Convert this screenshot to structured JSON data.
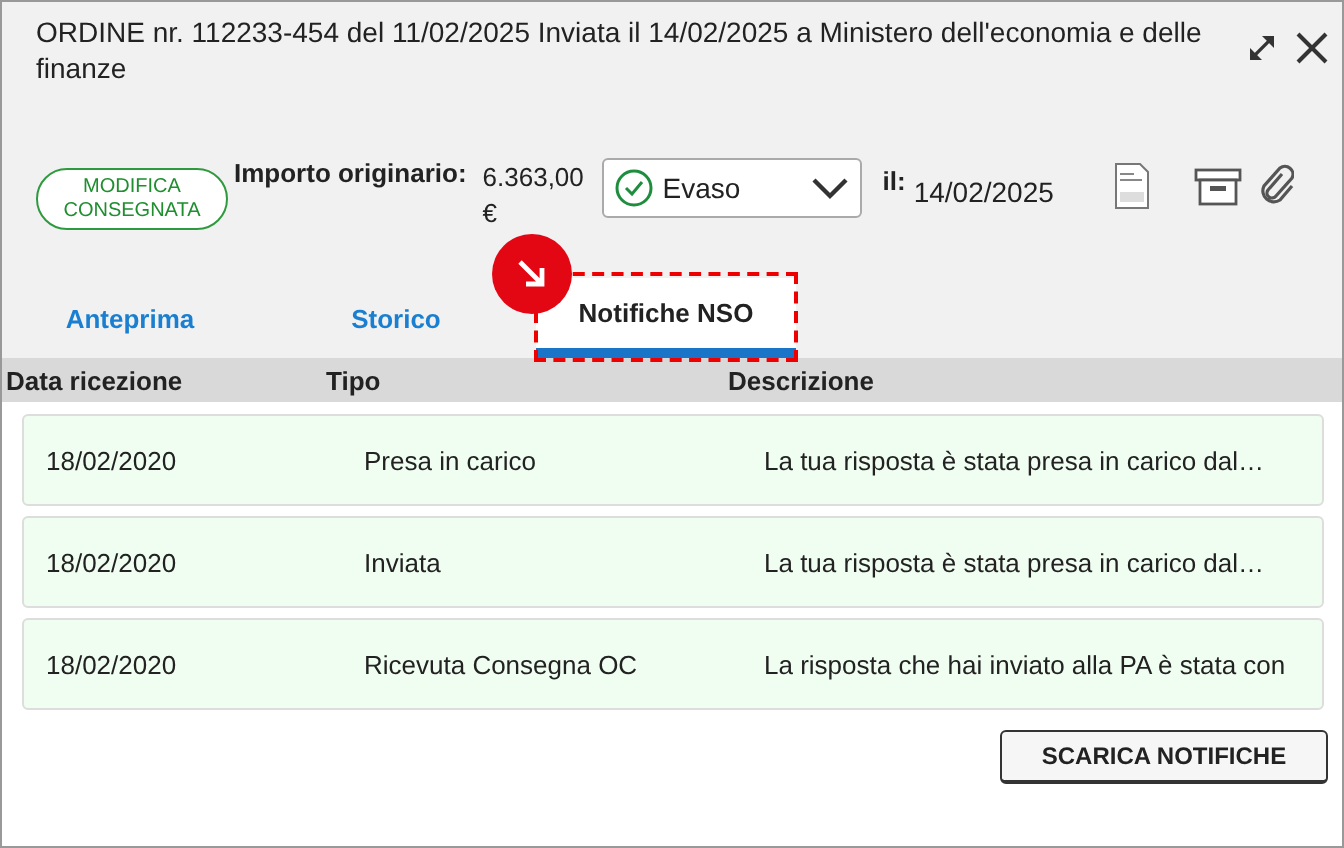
{
  "header": {
    "title": "ORDINE nr. 112233-454 del 11/02/2025 Inviata il 14/02/2025  a Ministero dell'economia e delle finanze"
  },
  "info": {
    "badge": "MODIFICA CONSEGNATA",
    "amount_label": "Importo originario:",
    "amount": "6.363,00 €",
    "status": {
      "value": "Evaso"
    },
    "date_label": "il:",
    "date": "14/02/2025"
  },
  "tabs": [
    {
      "label": "Anteprima",
      "selected": false
    },
    {
      "label": "Storico",
      "selected": false
    },
    {
      "label": "Notifiche NSO",
      "selected": true,
      "highlighted": true
    }
  ],
  "table": {
    "columns": [
      "Data ricezione",
      "Tipo",
      "Descrizione"
    ],
    "rows": [
      [
        "18/02/2020",
        "Presa in carico",
        "La tua risposta è stata presa in carico dal…"
      ],
      [
        "18/02/2020",
        "Inviata",
        "La tua risposta è stata presa in carico dal…"
      ],
      [
        "18/02/2020",
        "Ricevuta Consegna OC",
        "La risposta che hai inviato alla PA è stata con"
      ]
    ]
  },
  "buttons": [
    "SCARICA NOTIFICHE"
  ]
}
